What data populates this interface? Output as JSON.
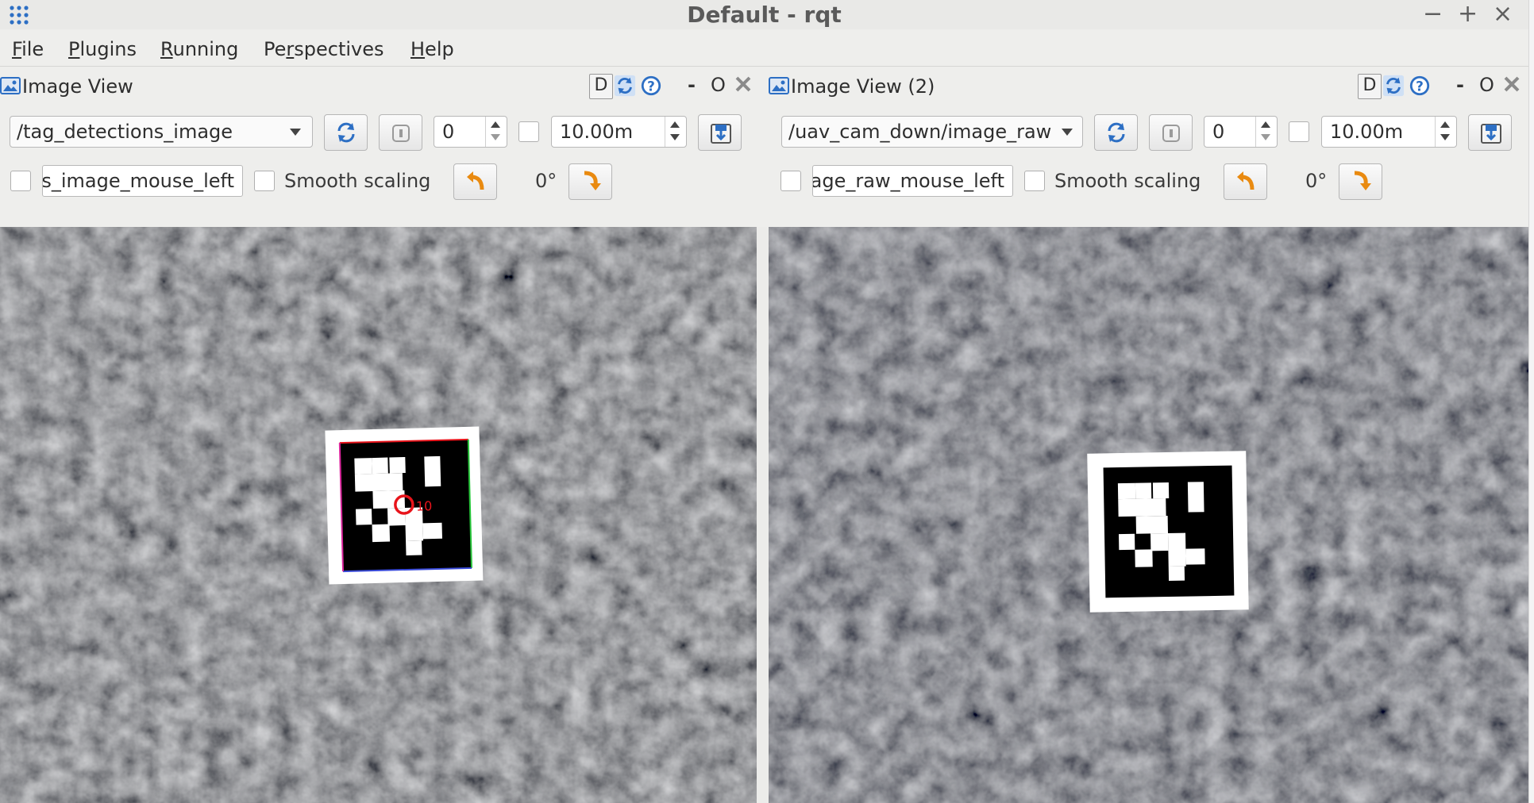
{
  "window": {
    "title": "Default - rqt",
    "minimize": "−",
    "maximize": "+",
    "close": "×"
  },
  "menubar": {
    "file": {
      "mnemonic": "F",
      "rest": "ile"
    },
    "plugins": {
      "mnemonic": "P",
      "rest": "lugins"
    },
    "running": {
      "mnemonic": "R",
      "rest": "unning"
    },
    "perspectives": {
      "pre": "Pe",
      "mnemonic": "r",
      "rest": "spectives"
    },
    "help": {
      "mnemonic": "H",
      "rest": "elp"
    }
  },
  "left": {
    "title": "Image View",
    "d_button": "D",
    "min": "-",
    "float": "O",
    "topic": "/tag_detections_image",
    "frame": "0",
    "max_range": "10.00m",
    "mouse_topic": "tag_detections_image_mouse_left",
    "smooth_scaling": "Smooth scaling",
    "rotation": "0°",
    "overlay_id": "10"
  },
  "right": {
    "title": "Image View (2)",
    "d_button": "D",
    "min": "-",
    "float": "O",
    "topic": "/uav_cam_down/image_raw",
    "frame": "0",
    "max_range": "10.00m",
    "mouse_topic": "uav_cam_down/image_raw_mouse_left",
    "smooth_scaling": "Smooth scaling",
    "rotation": "0°"
  },
  "colors": {
    "accent_blue": "#2d6fc4",
    "rotate_orange": "#e98a10",
    "overlay_red": "#e8141b",
    "asphalt": "#5c5e62"
  },
  "icons": {
    "app_menu": "grid-dots-icon",
    "dock_title": "image-view-icon",
    "reload": "refresh-icon",
    "help": "help-icon",
    "pause": "pause-icon",
    "save": "save-image-icon",
    "rotate_left": "rotate-left-icon",
    "rotate_right": "rotate-right-icon"
  }
}
